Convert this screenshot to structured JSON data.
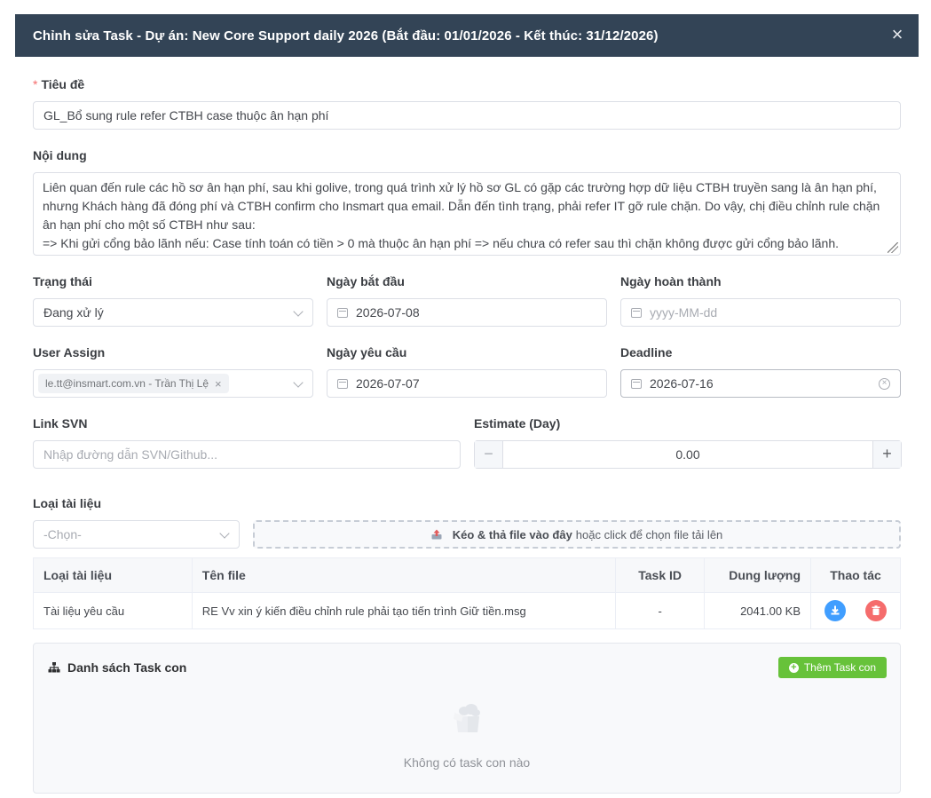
{
  "header": {
    "title": "Chỉnh sửa Task - Dự án: New Core Support daily 2026 (Bắt đầu: 01/01/2026 - Kết thúc: 31/12/2026)",
    "close_symbol": "×"
  },
  "form": {
    "title_label": "Tiêu đề",
    "required_mark": "*",
    "title_value": "GL_Bổ sung rule refer CTBH case thuộc ân hạn phí",
    "content_label": "Nội dung",
    "content_lines": [
      "Liên quan đến rule các hồ sơ ân hạn phí, sau khi golive, trong quá trình xử lý hồ sơ GL có gặp các trường hợp dữ liệu CTBH truyền sang là ân hạn phí,",
      "nhưng Khách hàng đã đóng phí và CTBH confirm cho Insmart qua email. Dẫn đến tình trạng, phải refer IT gỡ rule chặn. Do vậy, chị điều chỉnh rule chặn",
      "ân hạn phí cho một số CTBH như sau:",
      "=> Khi gửi cổng bảo lãnh nếu: Case tính toán có tiền > 0 mà thuộc ân hạn phí => nếu chưa có refer sau thì chặn không được gửi cổng bảo lãnh."
    ],
    "status_label": "Trạng thái",
    "status_value": "Đang xử lý",
    "start_date_label": "Ngày bắt đầu",
    "start_date_value": "2026-07-08",
    "complete_date_label": "Ngày hoàn thành",
    "complete_date_placeholder": "yyyy-MM-dd",
    "user_assign_label": "User Assign",
    "user_assign_tag": "le.tt@insmart.com.vn - Trần Thị Lệ",
    "request_date_label": "Ngày yêu cầu",
    "request_date_value": "2026-07-07",
    "deadline_label": "Deadline",
    "deadline_value": "2026-07-16",
    "svn_label": "Link SVN",
    "svn_placeholder": "Nhập đường dẫn SVN/Github...",
    "estimate_label": "Estimate (Day)",
    "estimate_value": "0.00",
    "minus_symbol": "−",
    "plus_symbol": "+",
    "doc_type_label": "Loại tài liệu",
    "doc_type_placeholder": "-Chọn-",
    "upload_bold": "Kéo & thả file vào đây",
    "upload_rest": "hoặc click để chọn file tải lên"
  },
  "files_table": {
    "headers": [
      "Loại tài liệu",
      "Tên file",
      "Task ID",
      "Dung lượng",
      "Thao tác"
    ],
    "rows": [
      {
        "doc_type": "Tài liệu yêu cầu",
        "file_name": "RE Vv xin ý kiến điều chỉnh rule phải tạo tiến trình Giữ tiền.msg",
        "task_id": "-",
        "size": "2041.00 KB"
      }
    ]
  },
  "subtasks": {
    "title": "Danh sách Task con",
    "add_button": "Thêm Task con",
    "empty_text": "Không có task con nào"
  },
  "colors": {
    "header_bg": "#334456",
    "primary": "#409eff",
    "danger": "#f56c6c",
    "success": "#67c23a"
  }
}
